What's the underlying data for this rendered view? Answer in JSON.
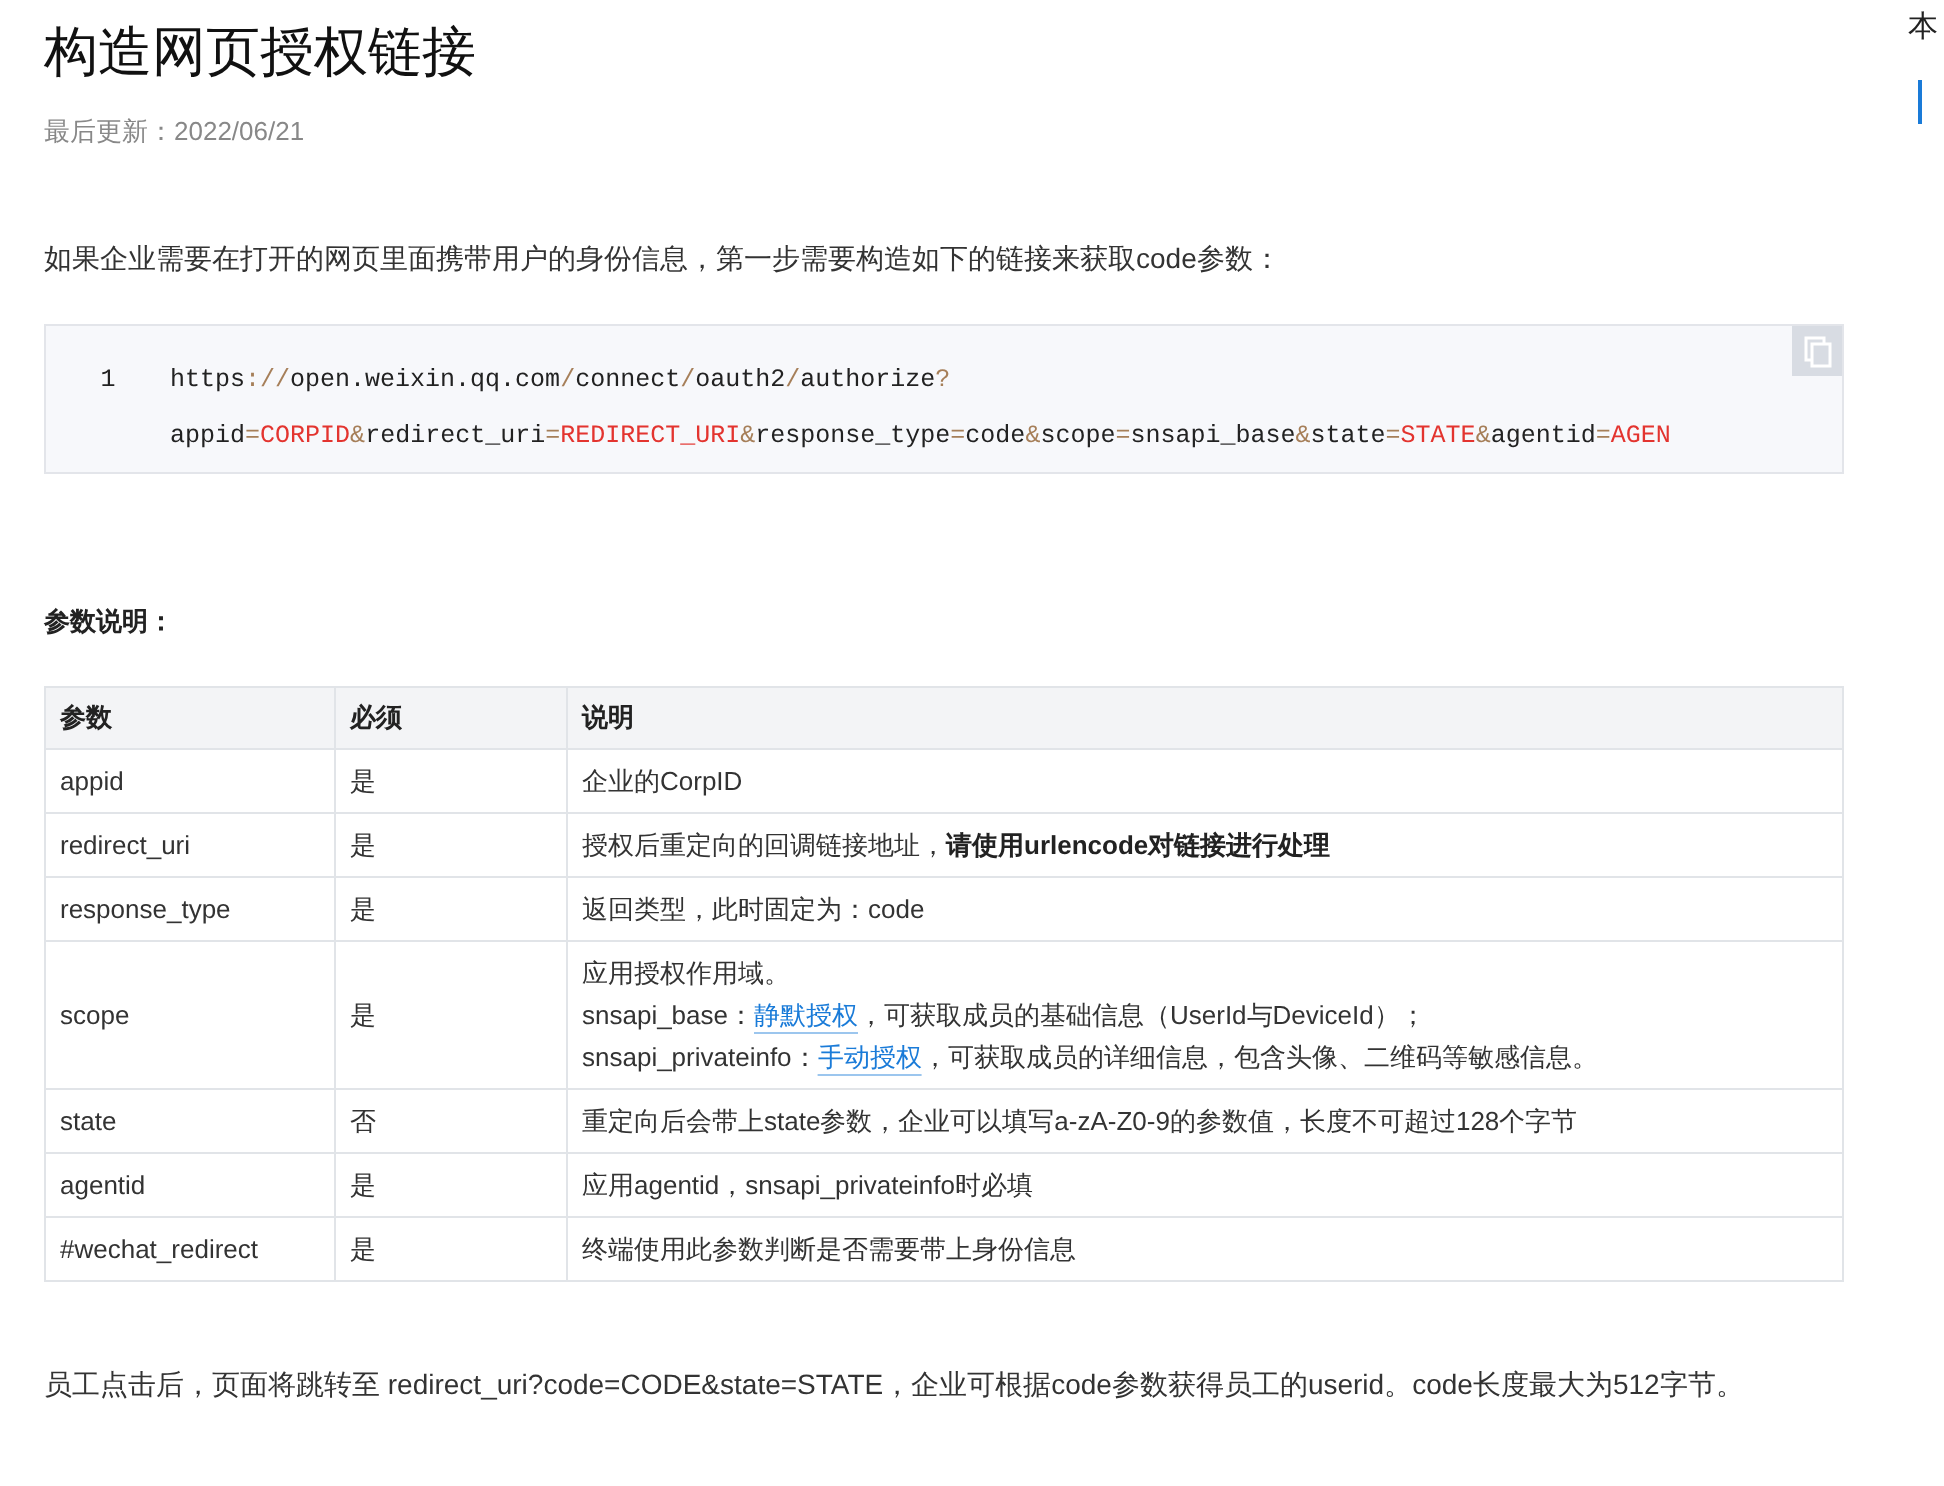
{
  "title": "构造网页授权链接",
  "updated": "最后更新：2022/06/21",
  "intro": "如果企业需要在打开的网页里面携带用户的身份信息，第一步需要构造如下的链接来获取code参数：",
  "code": {
    "line_number": "1",
    "rows": [
      {
        "tokens": [
          {
            "kind": "plain",
            "text": "https"
          },
          {
            "kind": "punct",
            "text": "://"
          },
          {
            "kind": "plain",
            "text": "open.weixin.qq.com"
          },
          {
            "kind": "punct",
            "text": "/"
          },
          {
            "kind": "plain",
            "text": "connect"
          },
          {
            "kind": "punct",
            "text": "/"
          },
          {
            "kind": "plain",
            "text": "oauth2"
          },
          {
            "kind": "punct",
            "text": "/"
          },
          {
            "kind": "plain",
            "text": "authorize"
          },
          {
            "kind": "punct",
            "text": "?"
          }
        ]
      },
      {
        "tokens": [
          {
            "kind": "plain",
            "text": "appid"
          },
          {
            "kind": "punct",
            "text": "="
          },
          {
            "kind": "value",
            "text": "CORPID"
          },
          {
            "kind": "punct",
            "text": "&"
          },
          {
            "kind": "plain",
            "text": "redirect_uri"
          },
          {
            "kind": "punct",
            "text": "="
          },
          {
            "kind": "value",
            "text": "REDIRECT_URI"
          },
          {
            "kind": "punct",
            "text": "&"
          },
          {
            "kind": "plain",
            "text": "response_type"
          },
          {
            "kind": "punct",
            "text": "="
          },
          {
            "kind": "plain",
            "text": "code"
          },
          {
            "kind": "punct",
            "text": "&"
          },
          {
            "kind": "plain",
            "text": "scope"
          },
          {
            "kind": "punct",
            "text": "="
          },
          {
            "kind": "plain",
            "text": "snsapi_base"
          },
          {
            "kind": "punct",
            "text": "&"
          },
          {
            "kind": "plain",
            "text": "state"
          },
          {
            "kind": "punct",
            "text": "="
          },
          {
            "kind": "value",
            "text": "STATE"
          },
          {
            "kind": "punct",
            "text": "&"
          },
          {
            "kind": "plain",
            "text": "agentid"
          },
          {
            "kind": "punct",
            "text": "="
          },
          {
            "kind": "value",
            "text": "AGEN"
          }
        ]
      }
    ]
  },
  "params_heading": "参数说明：",
  "table": {
    "columns": [
      "参数",
      "必须",
      "说明"
    ],
    "rows": [
      {
        "param": "appid",
        "required": "是",
        "description": [
          [
            {
              "kind": "plain",
              "text": "企业的CorpID"
            }
          ]
        ]
      },
      {
        "param": "redirect_uri",
        "required": "是",
        "description": [
          [
            {
              "kind": "plain",
              "text": "授权后重定向的回调链接地址，"
            },
            {
              "kind": "bold",
              "text": "请使用urlencode对链接进行处理"
            }
          ]
        ]
      },
      {
        "param": "response_type",
        "required": "是",
        "description": [
          [
            {
              "kind": "plain",
              "text": "返回类型，此时固定为：code"
            }
          ]
        ]
      },
      {
        "param": "scope",
        "required": "是",
        "description": [
          [
            {
              "kind": "plain",
              "text": "应用授权作用域。"
            }
          ],
          [
            {
              "kind": "plain",
              "text": "snsapi_base："
            },
            {
              "kind": "link",
              "text": "静默授权"
            },
            {
              "kind": "plain",
              "text": "，可获取成员的基础信息（UserId与DeviceId）；"
            }
          ],
          [
            {
              "kind": "plain",
              "text": "snsapi_privateinfo："
            },
            {
              "kind": "link",
              "text": "手动授权"
            },
            {
              "kind": "plain",
              "text": "，可获取成员的详细信息，包含头像、二维码等敏感信息。"
            }
          ]
        ]
      },
      {
        "param": "state",
        "required": "否",
        "description": [
          [
            {
              "kind": "plain",
              "text": "重定向后会带上state参数，企业可以填写a-zA-Z0-9的参数值，长度不可超过128个字节"
            }
          ]
        ]
      },
      {
        "param": "agentid",
        "required": "是",
        "description": [
          [
            {
              "kind": "plain",
              "text": "应用agentid，snsapi_privateinfo时必填"
            }
          ]
        ]
      },
      {
        "param": "#wechat_redirect",
        "required": "是",
        "description": [
          [
            {
              "kind": "plain",
              "text": "终端使用此参数判断是否需要带上身份信息"
            }
          ]
        ]
      }
    ]
  },
  "outro": "员工点击后，页面将跳转至 redirect_uri?code=CODE&state=STATE，企业可根据code参数获得员工的userid。code长度最大为512字节。",
  "toc": {
    "title": "本"
  }
}
